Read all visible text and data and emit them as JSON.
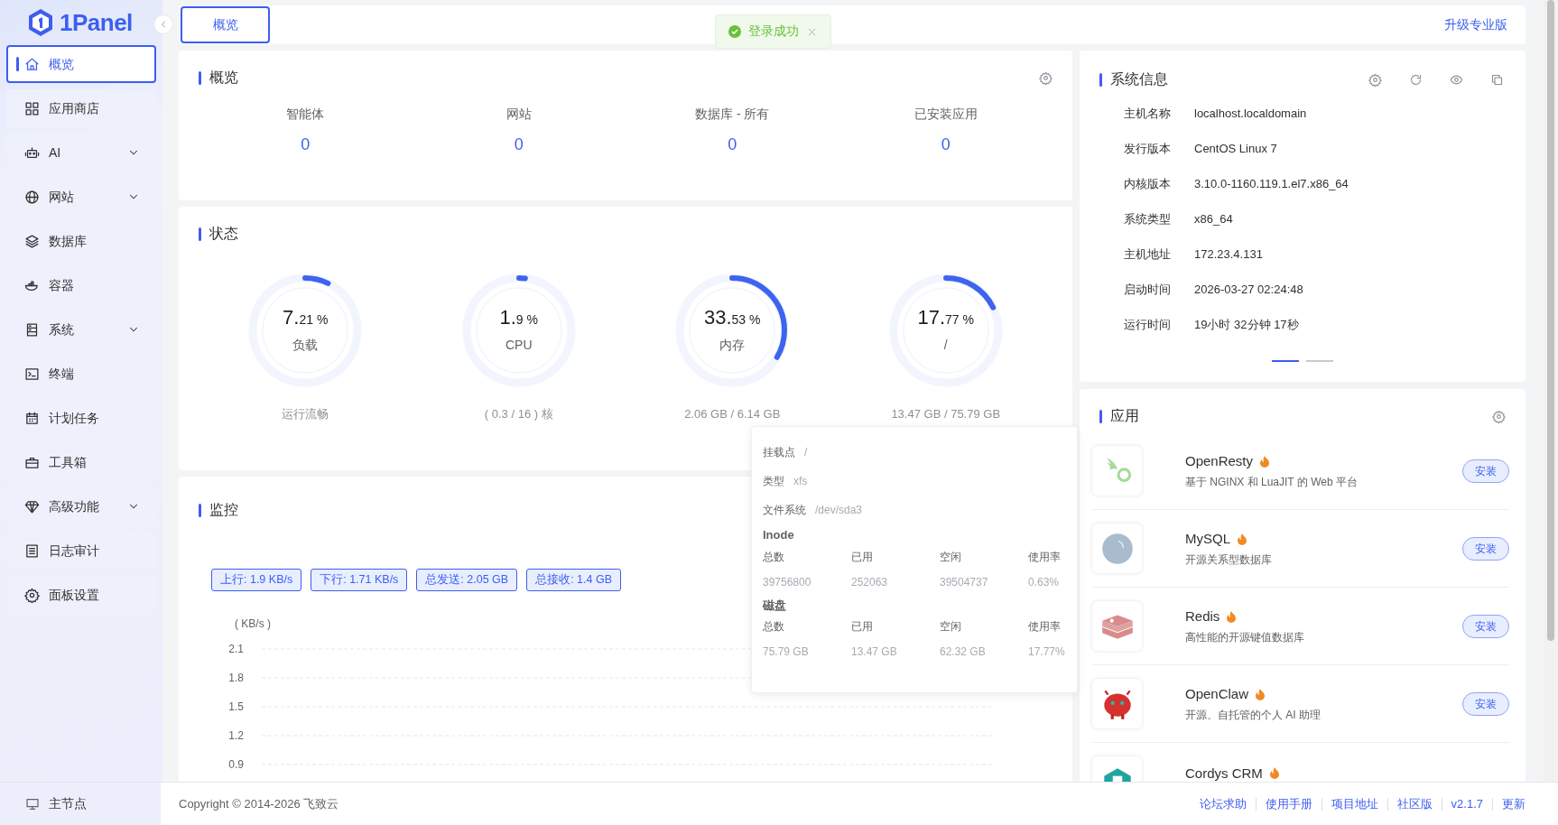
{
  "sidebar": {
    "logo": "1Panel",
    "items": [
      {
        "label": "概览",
        "selected": true,
        "has_submenu": false
      },
      {
        "label": "应用商店",
        "selected": false,
        "has_submenu": false
      },
      {
        "label": "AI",
        "selected": false,
        "has_submenu": true
      },
      {
        "label": "网站",
        "selected": false,
        "has_submenu": true
      },
      {
        "label": "数据库",
        "selected": false,
        "has_submenu": false
      },
      {
        "label": "容器",
        "selected": false,
        "has_submenu": false
      },
      {
        "label": "系统",
        "selected": false,
        "has_submenu": true
      },
      {
        "label": "终端",
        "selected": false,
        "has_submenu": false
      },
      {
        "label": "计划任务",
        "selected": false,
        "has_submenu": false
      },
      {
        "label": "工具箱",
        "selected": false,
        "has_submenu": false
      },
      {
        "label": "高级功能",
        "selected": false,
        "has_submenu": true
      },
      {
        "label": "日志审计",
        "selected": false,
        "has_submenu": false
      },
      {
        "label": "面板设置",
        "selected": false,
        "has_submenu": false
      }
    ],
    "node": "主节点"
  },
  "top_tabs": [
    {
      "label": "概览",
      "selected": true
    }
  ],
  "toast": {
    "message": "登录成功"
  },
  "upgrade_link": "升级专业版",
  "overview": {
    "title": "概览",
    "stats": [
      {
        "label": "智能体",
        "value": "0"
      },
      {
        "label": "网站",
        "value": "0"
      },
      {
        "label": "数据库 - 所有",
        "value": "0"
      },
      {
        "label": "已安装应用",
        "value": "0"
      }
    ]
  },
  "status": {
    "title": "状态",
    "gauges": [
      {
        "whole": "7.",
        "fraction": "21 %",
        "label": "负载",
        "level": 0.0721,
        "detail": "运行流畅"
      },
      {
        "whole": "1.",
        "fraction": "9 %",
        "label": "CPU",
        "level": 0.019,
        "detail": "( 0.3 / 16 ) 核"
      },
      {
        "whole": "33.",
        "fraction": "53 %",
        "label": "内存",
        "level": 0.3353,
        "detail": "2.06 GB / 6.14 GB"
      },
      {
        "whole": "17.",
        "fraction": "77 %",
        "label": "/",
        "level": 0.1777,
        "detail": "13.47 GB / 75.79 GB"
      }
    ]
  },
  "monitor": {
    "title": "监控",
    "badges": [
      "上行: 1.9 KB/s",
      "下行: 1.71 KB/s",
      "总发送: 2.05 GB",
      "总接收: 1.4 GB"
    ],
    "chart": {
      "unit_label": "( KB/s )",
      "y_axis_labels": [
        "2.1",
        "1.8",
        "1.5",
        "1.2",
        "0.9"
      ]
    }
  },
  "system_info": {
    "title": "系统信息",
    "rows": [
      {
        "label": "主机名称",
        "value": "localhost.localdomain"
      },
      {
        "label": "发行版本",
        "value": "CentOS Linux 7"
      },
      {
        "label": "内核版本",
        "value": "3.10.0-1160.119.1.el7.x86_64"
      },
      {
        "label": "系统类型",
        "value": "x86_64"
      },
      {
        "label": "主机地址",
        "value": "172.23.4.131"
      },
      {
        "label": "启动时间",
        "value": "2026-03-27 02:24:48"
      },
      {
        "label": "运行时间",
        "value": "19小时 32分钟 17秒"
      }
    ],
    "pages": [
      {
        "selected": true
      },
      {
        "selected": false
      }
    ]
  },
  "apps": {
    "title": "应用",
    "items": [
      {
        "name": "OpenResty",
        "hot": true,
        "description": "基于 NGINX 和 LuaJIT 的 Web 平台",
        "action": "安装"
      },
      {
        "name": "MySQL",
        "hot": true,
        "description": "开源关系型数据库",
        "action": "安装"
      },
      {
        "name": "Redis",
        "hot": true,
        "description": "高性能的开源键值数据库",
        "action": "安装"
      },
      {
        "name": "OpenClaw",
        "hot": true,
        "description": "开源、自托管的个人 AI 助理",
        "action": "安装"
      },
      {
        "name": "Cordys CRM",
        "hot": true
      }
    ]
  },
  "disk_popover": {
    "fields": [
      {
        "label": "挂载点",
        "value": "/"
      },
      {
        "label": "类型",
        "value": "xfs"
      },
      {
        "label": "文件系统",
        "value": "/dev/sda3"
      }
    ],
    "sections": [
      {
        "title": "Inode",
        "columns": [
          "总数",
          "已用",
          "空闲",
          "使用率"
        ],
        "values": [
          "39756800",
          "252063",
          "39504737",
          "0.63%"
        ]
      },
      {
        "title": "磁盘",
        "columns": [
          "总数",
          "已用",
          "空闲",
          "使用率"
        ],
        "values": [
          "75.79 GB",
          "13.47 GB",
          "62.32 GB",
          "17.77%"
        ]
      }
    ]
  },
  "footer": {
    "copyright": "Copyright © 2014-2026 飞致云",
    "links": [
      "论坛求助",
      "使用手册",
      "项目地址",
      "社区版",
      "v2.1.7",
      "更新"
    ]
  }
}
